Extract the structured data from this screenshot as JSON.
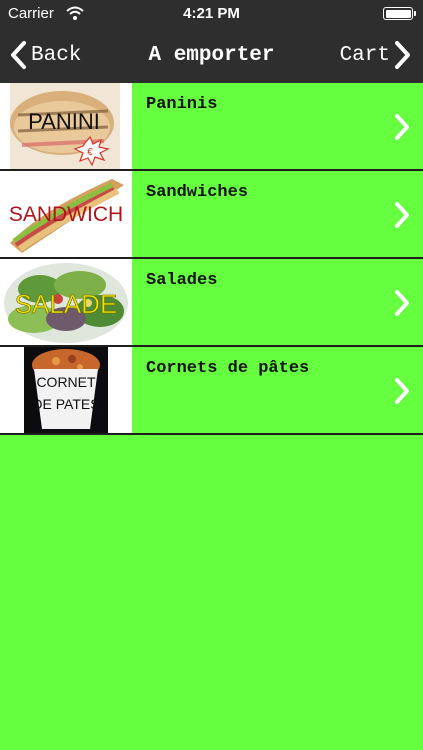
{
  "status": {
    "carrier": "Carrier",
    "time": "4:21 PM"
  },
  "nav": {
    "back_label": "Back",
    "title": "A emporter",
    "cart_label": "Cart"
  },
  "items": [
    {
      "label": "Paninis",
      "image_text": "PANINI",
      "badge": "€"
    },
    {
      "label": "Sandwiches",
      "image_text": "SANDWICH"
    },
    {
      "label": "Salades",
      "image_text": "SALADE"
    },
    {
      "label": "Cornets de pâtes",
      "image_text_line1": "CORNET",
      "image_text_line2": "DE PATES"
    }
  ],
  "colors": {
    "background": "#66FF3F",
    "bar": "#2E2E2E"
  }
}
